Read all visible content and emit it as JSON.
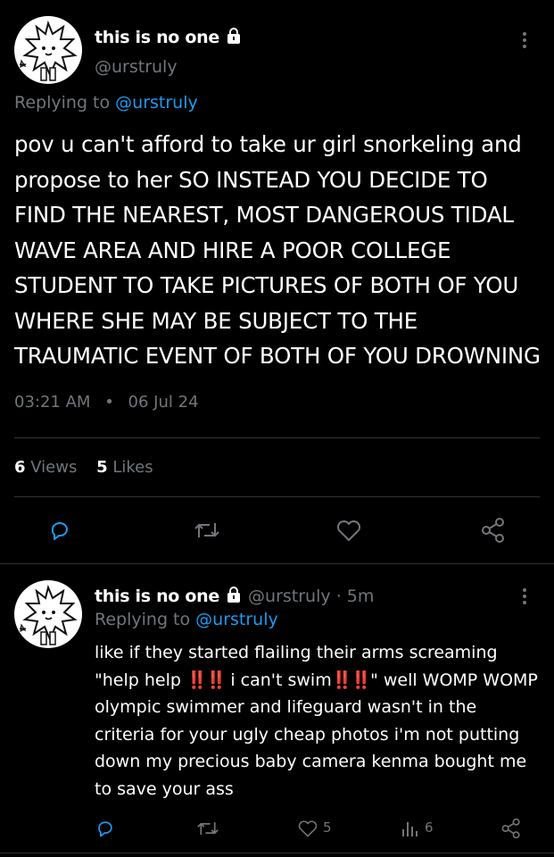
{
  "main_tweet": {
    "display_name": "this is no one",
    "handle": "@urstruly",
    "replying_label": "Replying to",
    "replying_handle": "@urstruly",
    "text": "pov u can't afford to take ur girl snorkeling and propose to her SO INSTEAD YOU DECIDE TO FIND THE NEAREST, MOST DANGEROUS TIDAL WAVE AREA AND HIRE A POOR COLLEGE STUDENT TO TAKE PICTURES OF BOTH OF YOU WHERE SHE MAY BE SUBJECT TO THE TRAUMATIC EVENT OF BOTH OF YOU DROWNING",
    "time": "03:21 AM",
    "separator": "•",
    "date": "06 Jul 24",
    "views_count": "6",
    "views_label": "Views",
    "likes_count": "5",
    "likes_label": "Likes"
  },
  "reply_tweet": {
    "display_name": "this is no one",
    "handle": "@urstruly",
    "time_ago": "· 5m",
    "replying_label": "Replying to",
    "replying_handle": "@urstruly",
    "text_part1": "like if they started flailing their arms screaming \"help help ",
    "bang1": "‼️‼️",
    "text_part2": " i can't swim",
    "bang2": "‼️‼️",
    "text_part3": "\" well WOMP WOMP olympic swimmer and lifeguard wasn't in the criteria for your ugly cheap photos i'm not putting down my precious baby camera kenma bought me to save your ass",
    "like_count": "5",
    "views_count": "6"
  },
  "icons": {
    "lock": "lock-icon",
    "more": "more-vertical-icon",
    "reply": "reply-icon",
    "retweet": "retweet-icon",
    "like": "heart-icon",
    "share": "share-icon",
    "views": "views-bar-icon"
  },
  "colors": {
    "background": "#000000",
    "text": "#ffffff",
    "muted": "#71767b",
    "link": "#1d9bf0",
    "divider": "#2f3336"
  }
}
